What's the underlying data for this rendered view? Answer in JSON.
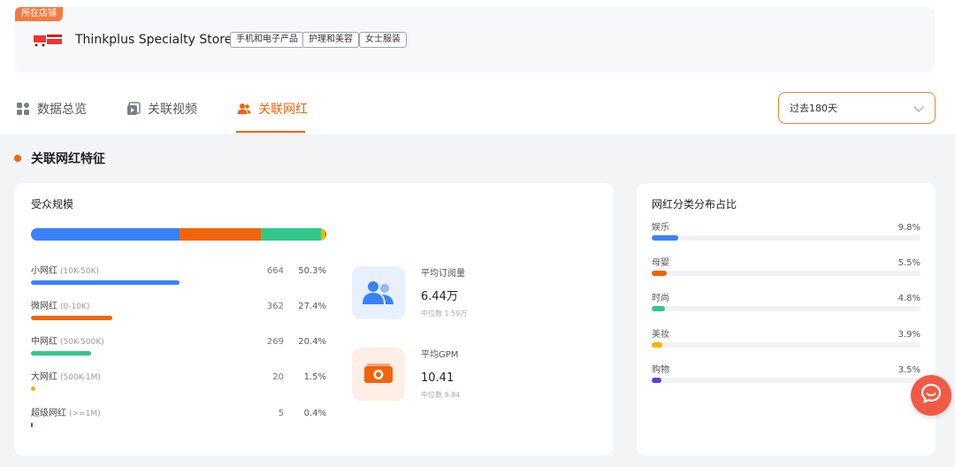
{
  "store": {
    "tag": "所在店铺",
    "name": "Thinkplus Specialty Store",
    "categories": [
      "手机和电子产品",
      "护理和美容",
      "女士服装"
    ]
  },
  "tabs": [
    {
      "label": "数据总览",
      "icon": "grid-icon",
      "active": false
    },
    {
      "label": "关联视频",
      "icon": "video-icon",
      "active": false
    },
    {
      "label": "关联网红",
      "icon": "users-icon",
      "active": true
    }
  ],
  "period_select": {
    "value": "过去180天"
  },
  "section": {
    "title": "关联网红特征"
  },
  "audience": {
    "title": "受众规模",
    "tiers": [
      {
        "name": "小网红",
        "range": "(10K-50K)",
        "count": "664",
        "pct": "50.3%",
        "share": 50.3,
        "color": "#3b82f6"
      },
      {
        "name": "微网红",
        "range": "(0-10K)",
        "count": "362",
        "pct": "27.4%",
        "share": 27.4,
        "color": "#f0650b"
      },
      {
        "name": "中网红",
        "range": "(50K-500K)",
        "count": "269",
        "pct": "20.4%",
        "share": 20.4,
        "color": "#34c78a"
      },
      {
        "name": "大网红",
        "range": "(500K-1M)",
        "count": "20",
        "pct": "1.5%",
        "share": 1.5,
        "color": "#f5b400"
      },
      {
        "name": "超级网红",
        "range": "(>=1M)",
        "count": "5",
        "pct": "0.4%",
        "share": 0.4,
        "color": "#3b4fd8"
      }
    ]
  },
  "metrics": {
    "subscribers": {
      "label": "平均订阅量",
      "value": "6.44万",
      "median": "中位数 1.59万",
      "icon": "users-icon"
    },
    "gpm": {
      "label": "平均GPM",
      "value": "10.41",
      "median": "中位数 9.84",
      "icon": "money-icon"
    }
  },
  "category_dist": {
    "title": "网红分类分布占比",
    "items": [
      {
        "name": "娱乐",
        "pct": "9.8%",
        "share": 9.8,
        "color": "#3b82f6"
      },
      {
        "name": "母婴",
        "pct": "5.5%",
        "share": 5.5,
        "color": "#f0650b"
      },
      {
        "name": "时尚",
        "pct": "4.8%",
        "share": 4.8,
        "color": "#34c78a"
      },
      {
        "name": "美妆",
        "pct": "3.9%",
        "share": 3.9,
        "color": "#f5b400"
      },
      {
        "name": "购物",
        "pct": "3.5%",
        "share": 3.5,
        "color": "#5b3fd8"
      }
    ]
  }
}
